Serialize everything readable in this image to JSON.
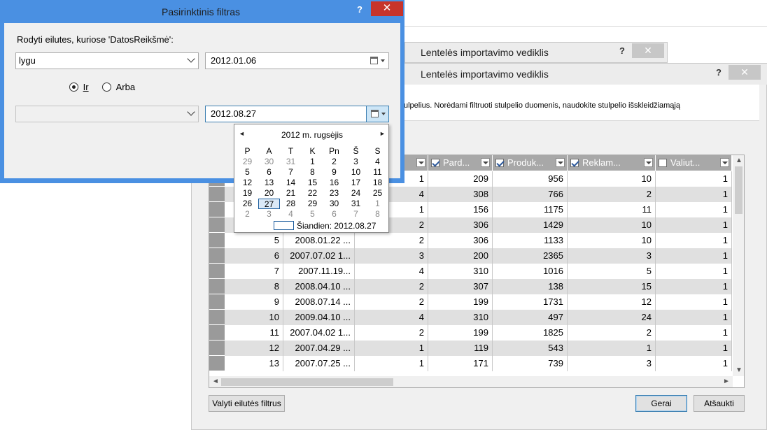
{
  "filter_dialog": {
    "title": "Pasirinktinis filtras",
    "help": "?",
    "close": "✕",
    "prompt": "Rodyti eilutes, kuriose 'DatosReikšmė':",
    "condition1": {
      "operator": "lygu",
      "value": "2012.01.06"
    },
    "radio_and": "Ir",
    "radio_or": "Arba",
    "condition2": {
      "operator": "",
      "value": "2012.08.27"
    }
  },
  "calendar": {
    "month_label": "2012 m. rugsėjis",
    "prev": "◄",
    "next": "►",
    "weekdays": [
      "P",
      "A",
      "T",
      "K",
      "Pn",
      "Š",
      "S"
    ],
    "weeks": [
      [
        "29",
        "30",
        "31",
        "1",
        "2",
        "3",
        "4"
      ],
      [
        "5",
        "6",
        "7",
        "8",
        "9",
        "10",
        "11"
      ],
      [
        "12",
        "13",
        "14",
        "15",
        "16",
        "17",
        "18"
      ],
      [
        "19",
        "20",
        "21",
        "22",
        "23",
        "24",
        "25"
      ],
      [
        "26",
        "27",
        "28",
        "29",
        "30",
        "31",
        "1"
      ],
      [
        "2",
        "3",
        "4",
        "5",
        "6",
        "7",
        "8"
      ]
    ],
    "today_label": "Šiandien: 2012.08.27"
  },
  "wizard_back": {
    "title": "Lentelės importavimo vediklis",
    "help": "?",
    "close": "✕"
  },
  "wizard": {
    "title": "Lentelės importavimo vediklis",
    "help": "?",
    "close": "✕",
    "instructions": "ulpelius. Norėdami filtruoti stulpelio duomenis, naudokite stulpelio išskleidžiamąją",
    "columns": [
      {
        "label": "Pard...",
        "checked": true
      },
      {
        "label": "Produk...",
        "checked": true
      },
      {
        "label": "Reklam...",
        "checked": true
      },
      {
        "label": "Valiut...",
        "checked": false
      }
    ],
    "rows": [
      [
        "",
        "",
        "1",
        "209",
        "956",
        "10",
        "1"
      ],
      [
        "",
        "",
        "4",
        "308",
        "766",
        "2",
        "1"
      ],
      [
        "",
        "",
        "1",
        "156",
        "1175",
        "11",
        "1"
      ],
      [
        "",
        "",
        "2",
        "306",
        "1429",
        "10",
        "1"
      ],
      [
        "5",
        "2008.01.22 ...",
        "2",
        "306",
        "1133",
        "10",
        "1"
      ],
      [
        "6",
        "2007.07.02 1...",
        "3",
        "200",
        "2365",
        "3",
        "1"
      ],
      [
        "7",
        "2007.11.19...",
        "4",
        "310",
        "1016",
        "5",
        "1"
      ],
      [
        "8",
        "2008.04.10 ...",
        "2",
        "307",
        "138",
        "15",
        "1"
      ],
      [
        "9",
        "2008.07.14 ...",
        "2",
        "199",
        "1731",
        "12",
        "1"
      ],
      [
        "10",
        "2009.04.10 ...",
        "4",
        "310",
        "497",
        "24",
        "1"
      ],
      [
        "11",
        "2007.04.02 1...",
        "2",
        "199",
        "1825",
        "2",
        "1"
      ],
      [
        "12",
        "2007.04.29 ...",
        "1",
        "119",
        "543",
        "1",
        "1"
      ],
      [
        "13",
        "2007.07.25 ...",
        "1",
        "171",
        "739",
        "3",
        "1"
      ]
    ],
    "clear_filter_button": "Valyti eilutės filtrus",
    "ok_button": "Gerai",
    "cancel_button": "Atšaukti"
  }
}
